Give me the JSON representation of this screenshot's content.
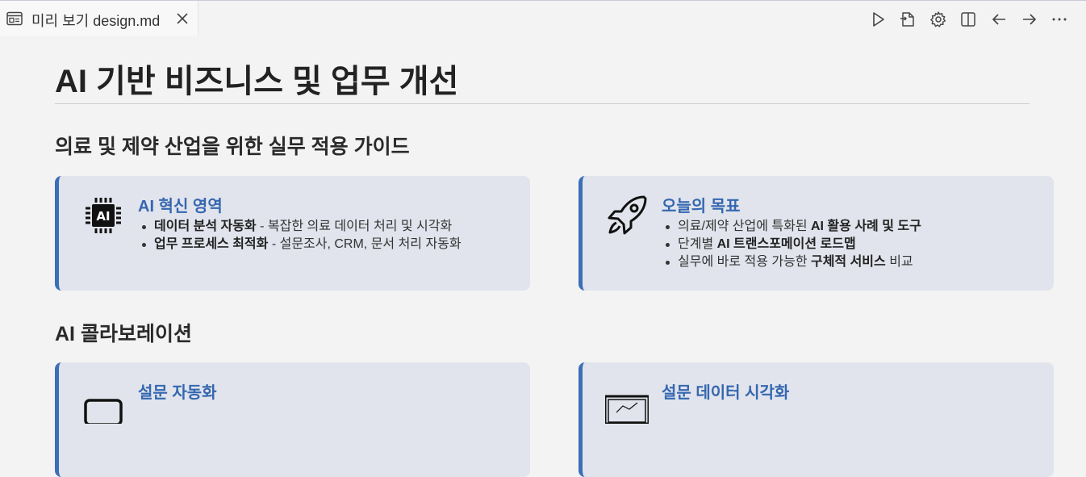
{
  "tab": {
    "label": "미리 보기 design.md",
    "icon": "preview-icon",
    "close_icon": "close-icon"
  },
  "actions": [
    {
      "name": "run-button",
      "icon": "play-icon"
    },
    {
      "name": "open-source-button",
      "icon": "open-file-icon"
    },
    {
      "name": "settings-button",
      "icon": "gear-icon"
    },
    {
      "name": "split-editor-button",
      "icon": "split-icon"
    },
    {
      "name": "back-button",
      "icon": "arrow-left-icon"
    },
    {
      "name": "forward-button",
      "icon": "arrow-right-icon"
    },
    {
      "name": "more-actions-button",
      "icon": "ellipsis-icon"
    }
  ],
  "doc": {
    "title": "AI 기반 비즈니스 및 업무 개선",
    "section1": "의료 및 제약 산업을 위한 실무 적용 가이드",
    "section2": "AI 콜라보레이션"
  },
  "cards": {
    "innovation": {
      "icon": "ai-chip-icon",
      "title": "AI 혁신 영역",
      "items": [
        {
          "bold": "데이터 분석 자동화",
          "pre": "",
          "post": " - 복잡한 의료 데이터 처리 및 시각화"
        },
        {
          "bold": "업무 프로세스 최적화",
          "pre": "",
          "post": " - 설문조사, CRM, 문서 처리 자동화"
        }
      ]
    },
    "goals": {
      "icon": "rocket-icon",
      "title": "오늘의 목표",
      "items": [
        {
          "pre": "의료/제약 산업에 특화된 ",
          "bold": "AI 활용 사례 및 도구",
          "post": ""
        },
        {
          "pre": "단계별 ",
          "bold": "AI 트랜스포메이션 로드맵",
          "post": ""
        },
        {
          "pre": "실무에 바로 적용 가능한 ",
          "bold": "구체적 서비스",
          "post": " 비교"
        }
      ]
    },
    "survey": {
      "icon": "monitor-icon",
      "title": "설문 자동화"
    },
    "visualization": {
      "icon": "chart-icon",
      "title": "설문 데이터 시각화"
    }
  },
  "colors": {
    "accent": "#3b6fb6",
    "card_title": "#3567b0",
    "card_bg": "#e1e4ec",
    "page_bg": "#f3f3f3"
  }
}
